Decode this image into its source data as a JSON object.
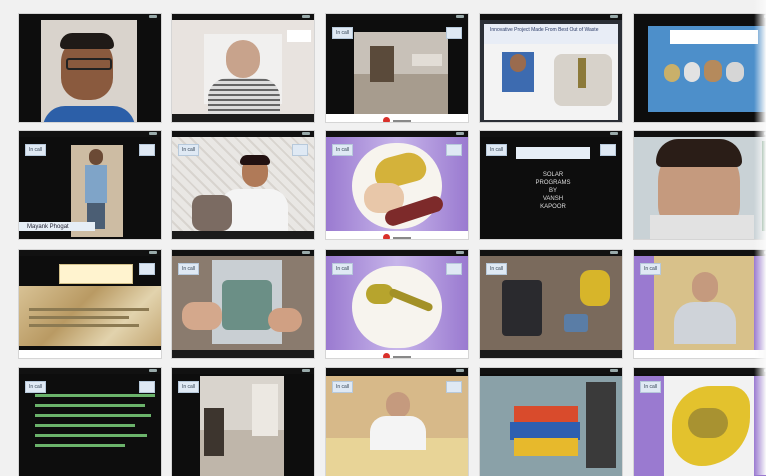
{
  "gallery": {
    "tiles": [
      {
        "scene": "person-blue-shirt"
      },
      {
        "scene": "person-striped-shirt"
      },
      {
        "scene": "room-floor"
      },
      {
        "scene": "slide-with-photo",
        "slide_title": "Innovative Project Made From Best Out of Waste"
      },
      {
        "scene": "blue-slide-objects"
      },
      {
        "scene": "black-with-standing-person",
        "caption": "Mayank Phogat"
      },
      {
        "scene": "person-pattern-wall"
      },
      {
        "scene": "purple-plate-spoon"
      },
      {
        "scene": "black-title-slide",
        "slide_lines": [
          "SOLAR",
          "PROGRAMS",
          "BY",
          "VANSH",
          "KAPOOR"
        ]
      },
      {
        "scene": "boy-closeup"
      },
      {
        "scene": "map-slide"
      },
      {
        "scene": "hands-craft"
      },
      {
        "scene": "purple-spoon"
      },
      {
        "scene": "phone-desk"
      },
      {
        "scene": "purple-boy-yellow"
      },
      {
        "scene": "green-text-slide"
      },
      {
        "scene": "corridor"
      },
      {
        "scene": "person-desk-yellow"
      },
      {
        "scene": "colorful-objects"
      },
      {
        "scene": "yellow-map-paper"
      }
    ],
    "badge_text": "In call"
  },
  "colors": {
    "tile_bg": "#0d0d0d",
    "record_dot": "#d9302a",
    "badge_bg": "#dfe9f4"
  }
}
